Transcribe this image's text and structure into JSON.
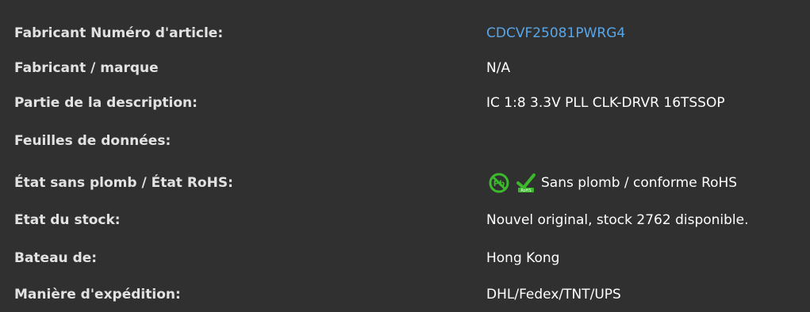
{
  "rows": [
    {
      "label": "Fabricant Numéro d'article:",
      "value": "CDCVF25081PWRG4"
    },
    {
      "label": "Fabricant / marque",
      "value": "N/A"
    },
    {
      "label": "Partie de la description:",
      "value": "IC 1:8 3.3V PLL CLK-DRVR 16TSSOP"
    },
    {
      "label": "Feuilles de données:",
      "value": ""
    },
    {
      "label": "État sans plomb / État RoHS:",
      "value": "Sans plomb / conforme RoHS"
    },
    {
      "label": "Etat du stock:",
      "value": "Nouvel original, stock 2762 disponible."
    },
    {
      "label": "Bateau de:",
      "value": "Hong Kong"
    },
    {
      "label": "Manière d'expédition:",
      "value": "DHL/Fedex/TNT/UPS"
    }
  ],
  "icons": {
    "lead_free": "lead-free-icon",
    "rohs": "rohs-compliant-icon",
    "rohs_badge_text": "RoHS"
  },
  "colors": {
    "background": "#303030",
    "label": "#e2e2e2",
    "value": "#ffffff",
    "link": "#58a6e8",
    "icon_green": "#3cb82c"
  }
}
